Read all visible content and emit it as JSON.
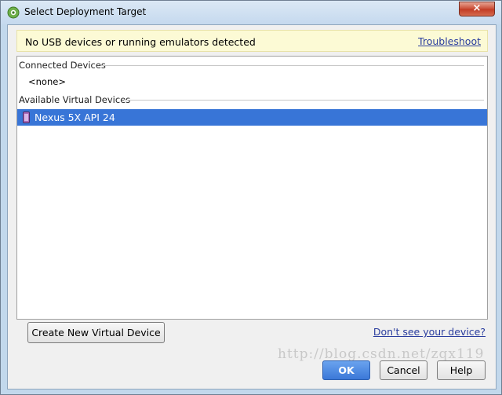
{
  "window": {
    "title": "Select Deployment Target",
    "close_label": "×"
  },
  "banner": {
    "message": "No USB devices or running emulators detected",
    "link": "Troubleshoot"
  },
  "connected": {
    "header": "Connected Devices",
    "empty_label": "<none>"
  },
  "virtual": {
    "header": "Available Virtual Devices",
    "devices": [
      {
        "name": "Nexus 5X API 24",
        "selected": true
      }
    ]
  },
  "actions": {
    "create_button": "Create New Virtual Device",
    "dont_see_link": "Don't see your device?",
    "ok": "OK",
    "cancel": "Cancel",
    "help": "Help"
  },
  "watermark": "http://blog.csdn.net/zqx119"
}
